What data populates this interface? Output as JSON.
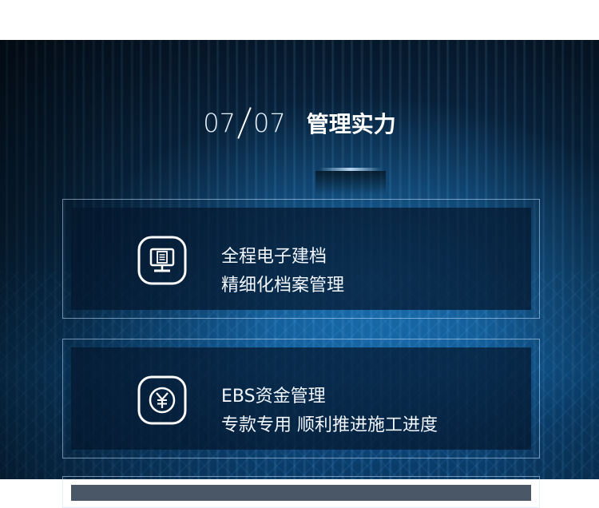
{
  "section": {
    "counter_current": "07",
    "counter_total": "07",
    "title": "管理实力"
  },
  "cards": [
    {
      "icon": "document-monitor-icon",
      "line1": "全程电子建档",
      "line2": "精细化档案管理"
    },
    {
      "icon": "yuan-coin-icon",
      "line1": "EBS资金管理",
      "line2": "专款专用 顺利推进施工进度"
    }
  ],
  "colors": {
    "accent": "#1e8fe0",
    "text": "#ffffff"
  }
}
